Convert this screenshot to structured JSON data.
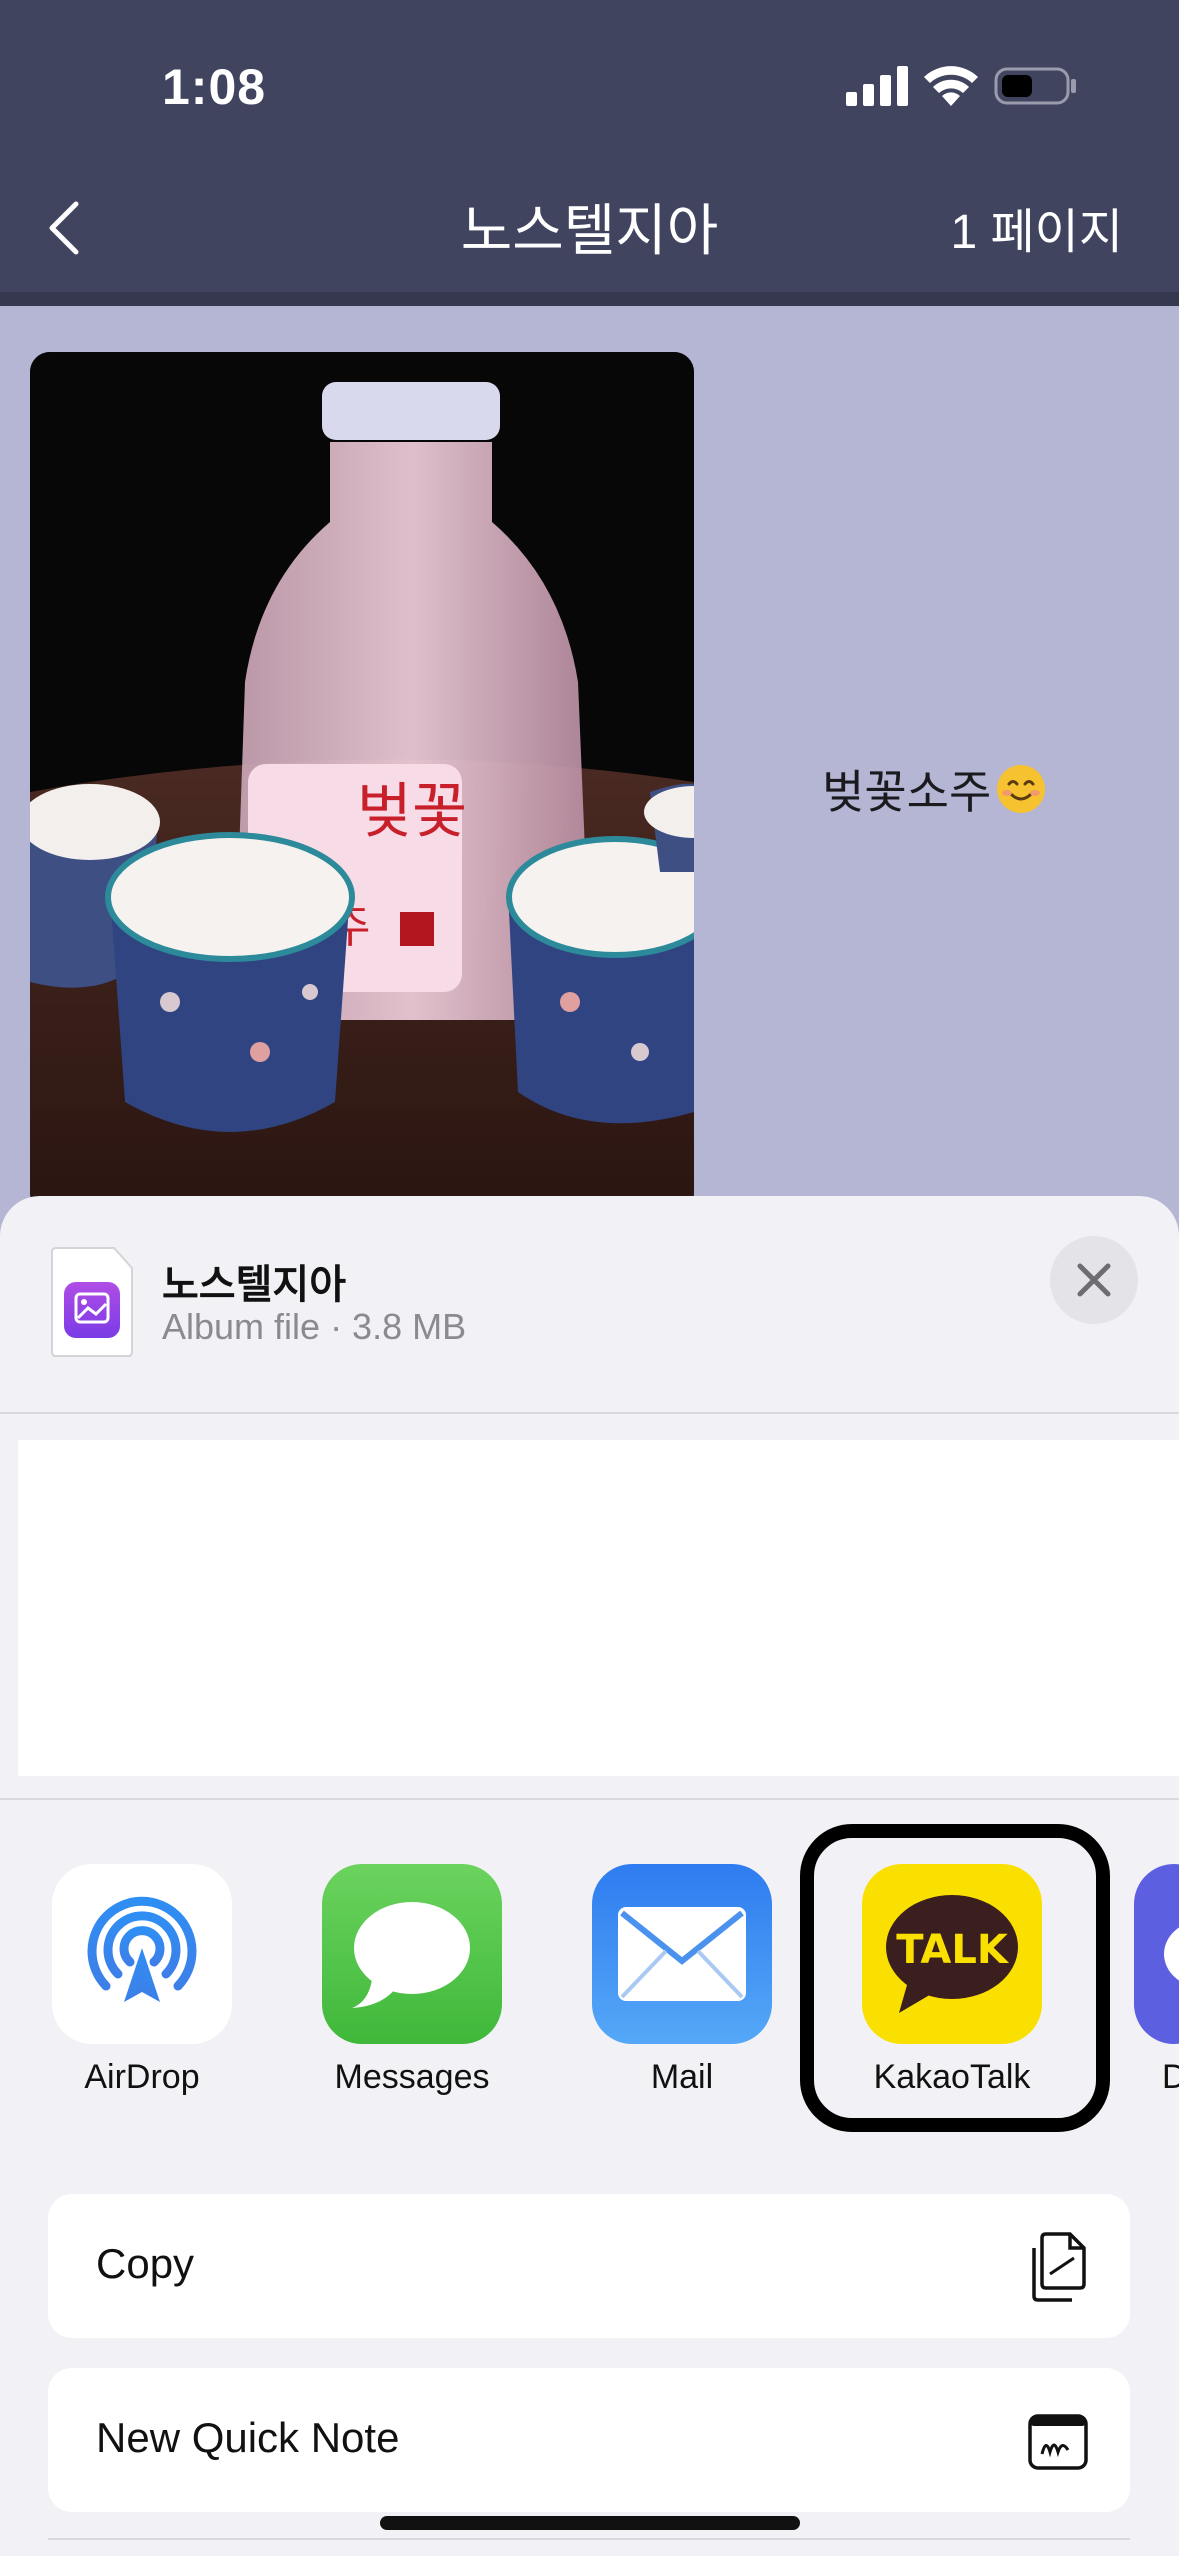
{
  "status_bar": {
    "time": "1:08"
  },
  "nav": {
    "title": "노스텔지아",
    "page_label": "1 페이지"
  },
  "album": {
    "photo_label_text": "벚꽃 소주",
    "caption": "벚꽃소주"
  },
  "share_sheet": {
    "file_name": "노스텔지아",
    "file_meta": "Album file · 3.8 MB",
    "apps": [
      {
        "label": "AirDrop",
        "icon": "airdrop-icon"
      },
      {
        "label": "Messages",
        "icon": "messages-icon"
      },
      {
        "label": "Mail",
        "icon": "mail-icon"
      },
      {
        "label": "KakaoTalk",
        "icon": "kakaotalk-icon",
        "tile_text": "TALK"
      },
      {
        "label": "D",
        "icon": "partial-app-icon"
      }
    ],
    "actions": [
      {
        "label": "Copy",
        "icon": "copy-icon"
      },
      {
        "label": "New Quick Note",
        "icon": "quick-note-icon"
      }
    ]
  },
  "colors": {
    "nav_bar": "#41445f",
    "content_bg": "#b4b6d4",
    "kakao_yellow": "#f9e000",
    "kakao_brown": "#3b1e1e"
  }
}
